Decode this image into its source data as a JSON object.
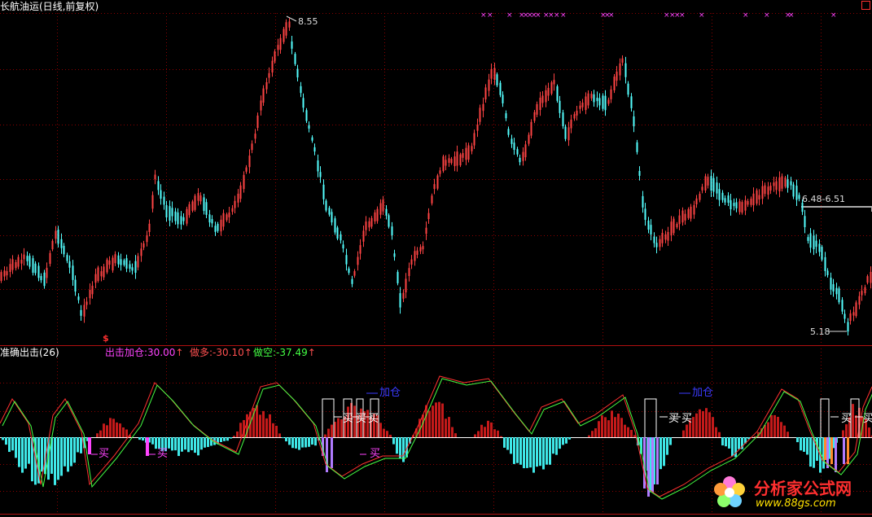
{
  "header": {
    "stock_title": "长航油运(日线,前复权)",
    "indicator_title": "准确出击(26)",
    "ind1_label": "出击加仓:",
    "ind1_value": "30.00",
    "ind2_label": "做多:",
    "ind2_value": "-30.10",
    "ind3_label": "做空:",
    "ind3_value": "-37.49",
    "arrow": "↑"
  },
  "price_panel": {
    "high_label": "8.55",
    "low_label": "5.18",
    "range_label": "6.48-6.51",
    "marker": "$",
    "top_marks_glyph": "×"
  },
  "annotations": {
    "buy": "买",
    "add": "加仓"
  },
  "watermark": {
    "text": "分析家公式网",
    "url": "www.88gs.com"
  },
  "colors": {
    "up": "#ff4444",
    "down": "#54ffff",
    "grid": "#8b0000",
    "magenta": "#ff44ff",
    "blue": "#3b3bff",
    "title": "#ffffff",
    "hist_red": "#c41a1a",
    "hist_cyan": "#3fe8e8"
  }
}
